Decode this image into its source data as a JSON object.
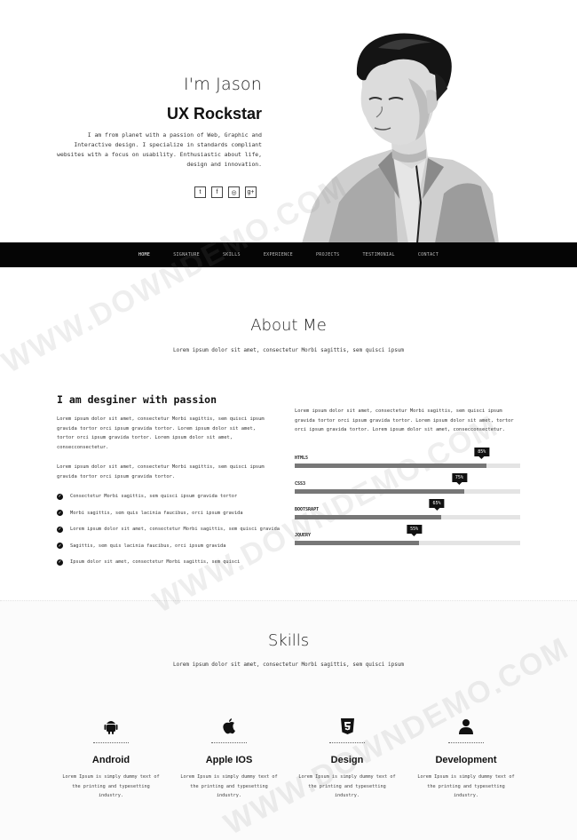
{
  "hero": {
    "greeting": "I'm Jason",
    "role": "UX Rockstar",
    "bio": "I am from planet with a passion of Web, Graphic and Interactive design. I specialize in standards compliant websites with a focus on usability. Enthusiastic about life, design and innovation.",
    "social": [
      "t",
      "f",
      "◎",
      "g+"
    ]
  },
  "nav": {
    "items": [
      "HOME",
      "SIGNATURE",
      "SKILLS",
      "EXPERIENCE",
      "PROJECTS",
      "TESTIMONIAL",
      "CONTACT"
    ]
  },
  "about": {
    "title": "About Me",
    "subtitle": "Lorem ipsum dolor sit amet, consectetur Morbi sagittis, sem quisci ipsum",
    "heading": "I am desginer with passion",
    "para1": "Lorem ipsum dolor sit amet, consectetur Morbi sagittis, sem quisci ipsum gravida tortor orci ipsum gravida tortor. Lorem ipsum dolor sit amet, tortor orci ipsum gravida tortor. Lorem ipsum dolor sit amet, consecconsectetur.",
    "para2": "Lorem ipsum dolor sit amet, consectetur Morbi sagittis, sem quisci ipsum gravida tortor orci ipsum gravida tortor.",
    "checklist": [
      "Consectetur Morbi sagittis, sem quisci ipsum gravida tortor",
      "Morbi sagittis, sem quis lacinia faucibus, orci ipsum gravida",
      "Lorem ipsum dolor sit amet, consectetur Morbi sagittis, sem quisci gravida",
      "Sagittis, sem quis lacinia faucibus, orci ipsum gravida",
      "Ipsum dolor sit amet, consectetur Morbi sagittis, sem quisci"
    ],
    "right_para": "Lorem ipsum dolor sit amet, consectetur Morbi sagittis, sem quisci ipsum gravida tortor orci ipsum gravida tortor. Lorem ipsum dolor sit amet, tortor orci ipsum gravida tortor. Lorem ipsum dolor sit amet, consecconsectetur.",
    "bars": [
      {
        "name": "HTML5",
        "label": "85%",
        "value": 85
      },
      {
        "name": "CSS3",
        "label": "75%",
        "value": 75
      },
      {
        "name": "BOOTSRAPT",
        "label": "65%",
        "value": 65
      },
      {
        "name": "JQUERY",
        "label": "55%",
        "value": 55
      }
    ]
  },
  "skills": {
    "title": "Skills",
    "subtitle": "Lorem ipsum dolor sit amet, consectetur Morbi sagittis, sem quisci ipsum",
    "items": [
      {
        "name": "Android",
        "icon": "android-icon",
        "desc": "Lorem Ipsum is simply dummy text of the printing and typesetting industry."
      },
      {
        "name": "Apple IOS",
        "icon": "apple-icon",
        "desc": "Lorem Ipsum is simply dummy text of the printing and typesetting industry."
      },
      {
        "name": "Design",
        "icon": "html5-icon",
        "desc": "Lorem Ipsum is simply dummy text of the printing and typesetting industry."
      },
      {
        "name": "Development",
        "icon": "user-icon",
        "desc": "Lorem Ipsum is simply dummy text of the printing and typesetting industry."
      }
    ]
  },
  "watermark": "WWW.DOWNDEMO.COM",
  "colors": {
    "nav_bg": "#050505",
    "bar_fill": "#777777",
    "bar_track": "#e4e4e4",
    "tooltip": "#111111"
  }
}
